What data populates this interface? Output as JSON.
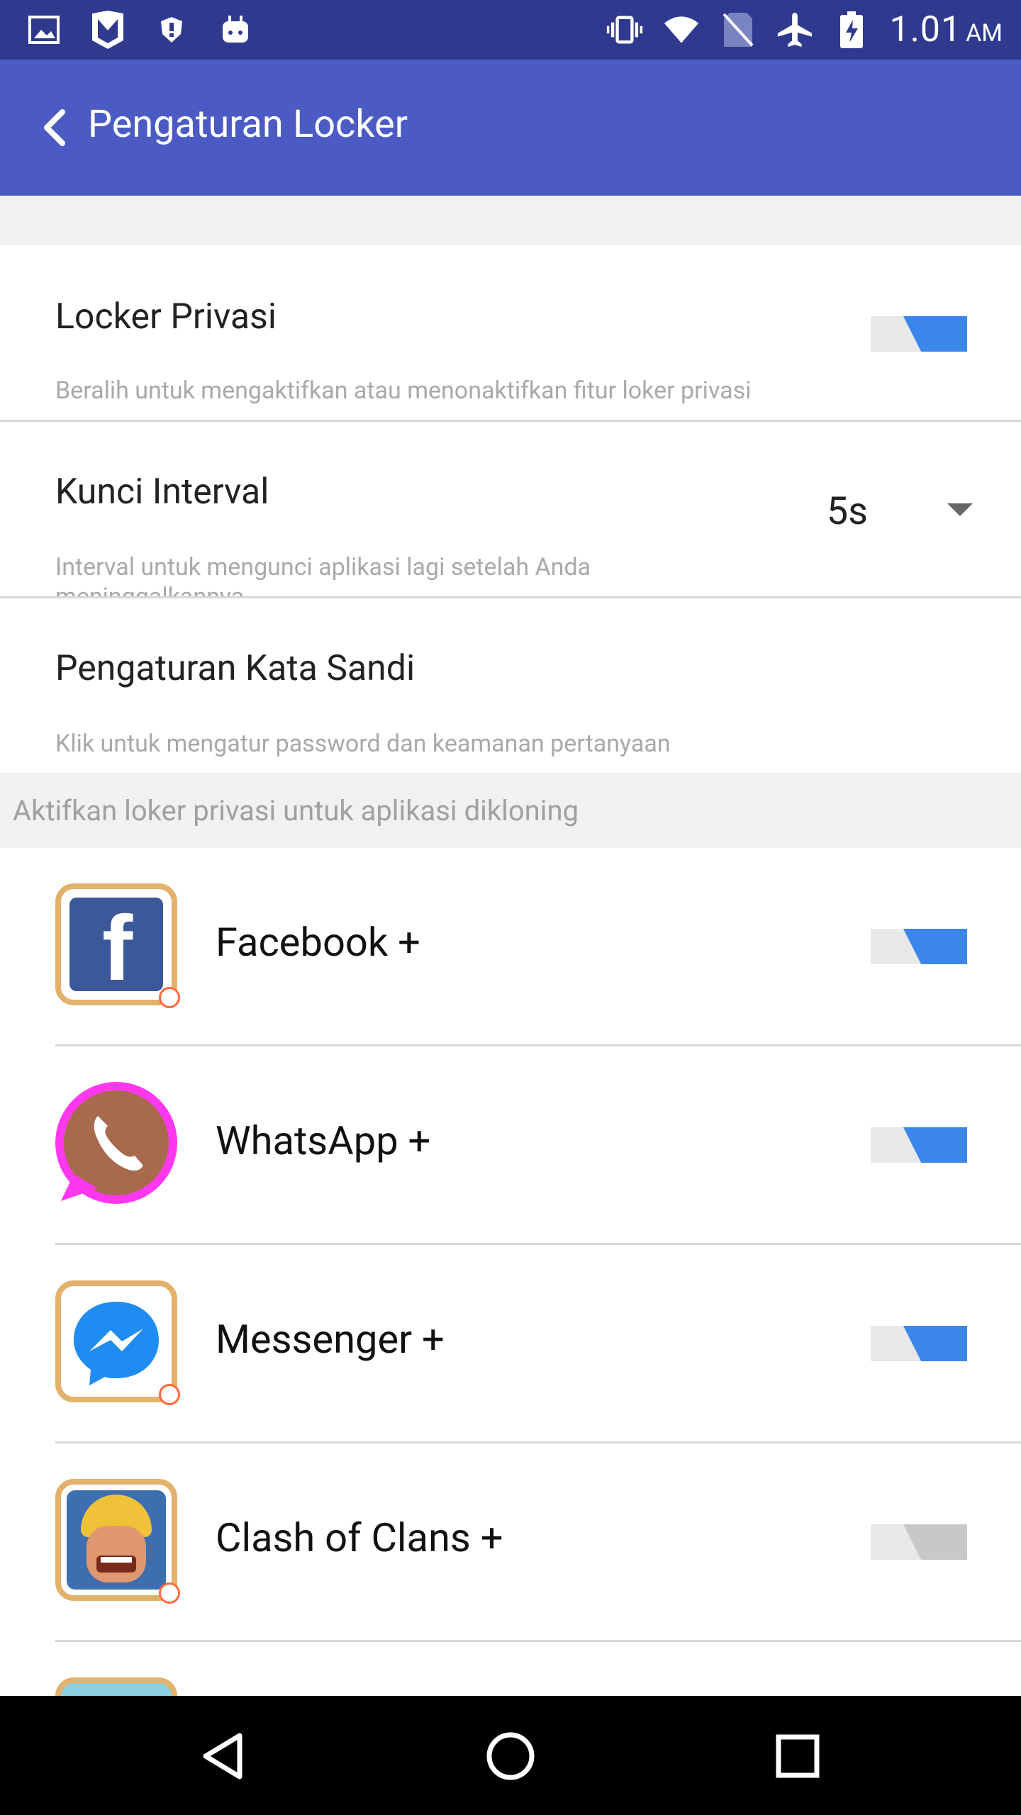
{
  "status_bar": {
    "time": "1.01",
    "ampm": "AM",
    "left_icons": [
      "gallery-icon",
      "shield-m-icon",
      "security-icon",
      "android-icon"
    ],
    "right_icons": [
      "vibrate-icon",
      "wifi-icon",
      "no-sim-icon",
      "airplane-icon",
      "battery-charging-icon"
    ]
  },
  "appbar": {
    "title": "Pengaturan Locker",
    "color": "#4b5bc3"
  },
  "settings": {
    "privacy_locker": {
      "title": "Locker Privasi",
      "subtitle": "Beralih untuk mengaktifkan atau menonaktifkan fitur loker privasi",
      "enabled": true
    },
    "lock_interval": {
      "title": "Kunci Interval",
      "subtitle": "Interval untuk mengunci aplikasi lagi setelah Anda meninggalkannya",
      "value": "5s"
    },
    "password": {
      "title": "Pengaturan Kata Sandi",
      "subtitle": "Klik untuk mengatur password dan keamanan pertanyaan"
    }
  },
  "section_header": "Aktifkan loker privasi untuk aplikasi dikloning",
  "apps": [
    {
      "name": "Facebook +",
      "icon": "facebook-icon",
      "enabled": true
    },
    {
      "name": "WhatsApp +",
      "icon": "whatsapp-icon",
      "enabled": true
    },
    {
      "name": "Messenger +",
      "icon": "messenger-icon",
      "enabled": true
    },
    {
      "name": "Clash of Clans +",
      "icon": "clash-of-clans-icon",
      "enabled": false
    }
  ],
  "colors": {
    "toggle_on": "#3b86ea",
    "toggle_off": "#c8c8c8",
    "statusbar": "#2f3a8f"
  }
}
